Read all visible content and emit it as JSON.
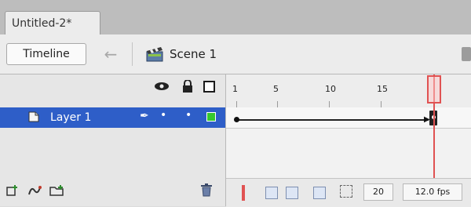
{
  "document": {
    "tab_title": "Untitled-2*"
  },
  "toolbar": {
    "timeline_label": "Timeline",
    "back_icon": "arrow-left-icon",
    "scene_icon": "clapperboard-icon",
    "scene_label": "Scene 1"
  },
  "layers": {
    "header_icons": [
      "eye-icon",
      "lock-icon",
      "outline-icon"
    ],
    "items": [
      {
        "name": "Layer 1",
        "visible_marker": "•",
        "lock_marker": "•",
        "color": "#35c92e",
        "selected": true
      }
    ],
    "tools": [
      "insert-layer-icon",
      "add-motion-guide-icon",
      "insert-folder-icon",
      "trash-icon"
    ]
  },
  "timeline": {
    "ruler_labels": [
      "1",
      "5",
      "10",
      "15"
    ],
    "current_frame": "20",
    "frame_rate": "12.0 fps",
    "colors": {
      "selection": "#2e5ec8",
      "playhead": "#e05252",
      "layer": "#35c92e"
    }
  }
}
